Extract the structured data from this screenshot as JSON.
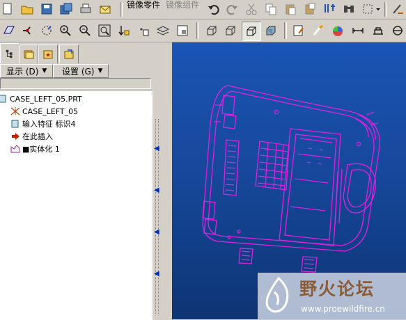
{
  "toolbar1": {
    "mirror_part_label": "镜像零件",
    "mirror_assembly_label": "镜像组件"
  },
  "left_panel": {
    "tabs": [
      "model-tree-tab",
      "layer-tree-tab",
      "favorites-tab",
      "connections-tab"
    ],
    "show_menu_label": "显示 (D)",
    "settings_menu_label": "设置 (G)",
    "tree": {
      "items": [
        {
          "label": "CASE_LEFT_05.PRT",
          "icon": "part-icon"
        },
        {
          "label": "CASE_LEFT_05",
          "icon": "csys-icon"
        },
        {
          "label": "输入特征 标识4",
          "icon": "import-feature-icon"
        },
        {
          "label": "在此插入",
          "icon": "insert-here-arrow-icon"
        },
        {
          "label": "■实体化 1",
          "icon": "solidify-icon"
        }
      ]
    }
  },
  "watermark": {
    "title": "野火论坛",
    "url": "www.proewildfire.cn"
  },
  "colors": {
    "viewport_top": "#1a55b5",
    "viewport_bottom": "#0d3574",
    "model_lines": "#e020e0"
  }
}
